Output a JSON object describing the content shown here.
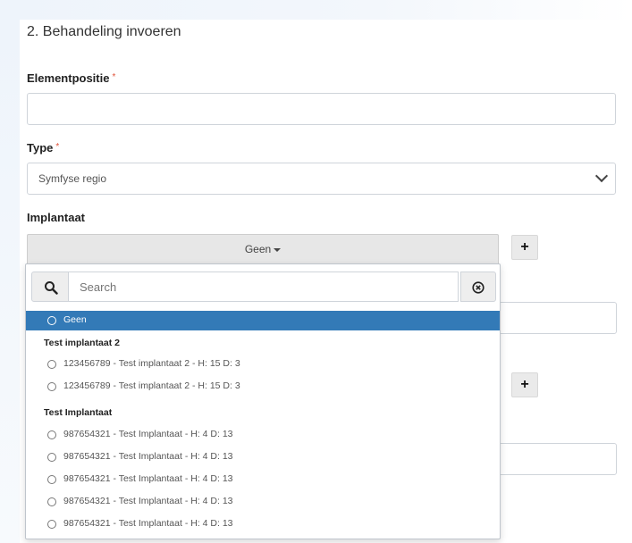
{
  "section": {
    "title": "2. Behandeling invoeren"
  },
  "fields": {
    "elementpositie": {
      "label": "Elementpositie",
      "required_mark": "*",
      "value": ""
    },
    "type": {
      "label": "Type",
      "required_mark": "*",
      "value": "Symfyse regio"
    },
    "implantaat": {
      "label": "Implantaat",
      "button_label": "Geen"
    }
  },
  "add_button": {
    "label": "+"
  },
  "dropdown": {
    "search": {
      "placeholder": "Search"
    },
    "selected_option": {
      "label": "Geen"
    },
    "groups": [
      {
        "name": "Test implantaat 2",
        "options": [
          "123456789 - Test implantaat 2 - H: 15 D: 3",
          "123456789 - Test implantaat 2 - H: 15 D: 3"
        ]
      },
      {
        "name": "Test Implantaat",
        "options": [
          "987654321 - Test Implantaat - H: 4 D: 13",
          "987654321 - Test Implantaat - H: 4 D: 13",
          "987654321 - Test Implantaat - H: 4 D: 13",
          "987654321 - Test Implantaat - H: 4 D: 13",
          "987654321 - Test Implantaat - H: 4 D: 13"
        ]
      }
    ]
  },
  "colors": {
    "selected_bg": "#337ab7",
    "required": "#e0523a"
  }
}
